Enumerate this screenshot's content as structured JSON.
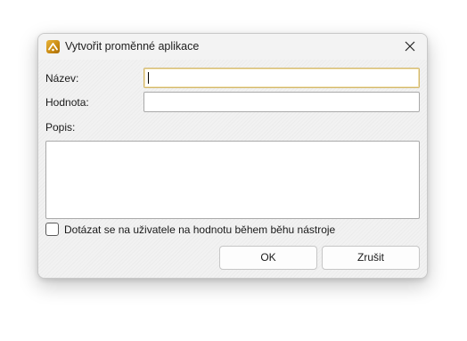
{
  "dialog": {
    "title": "Vytvořit proměnné aplikace",
    "app_icon": "app-logo-icon",
    "close_icon": "close-icon"
  },
  "form": {
    "name_label": "Název:",
    "name_value": "",
    "value_label": "Hodnota:",
    "value_value": "",
    "description_label": "Popis:",
    "description_value": "",
    "ask_user_checkbox_label": "Dotázat se na uživatele na hodnotu během běhu nástroje",
    "ask_user_checked": false
  },
  "buttons": {
    "ok_label": "OK",
    "cancel_label": "Zrušit"
  },
  "colors": {
    "focus_border": "#d3b76b",
    "dialog_bg": "#f0f0f0"
  }
}
